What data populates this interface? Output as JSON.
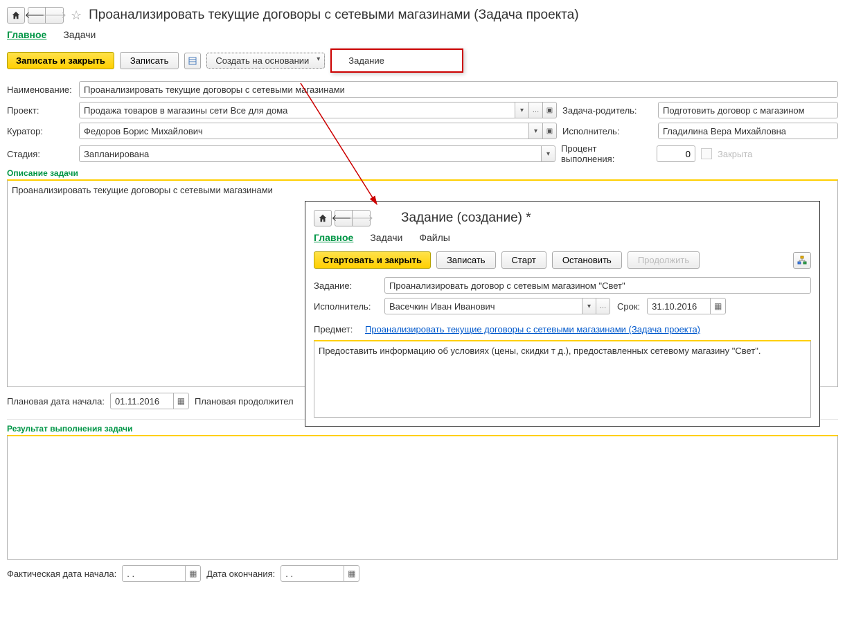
{
  "header": {
    "title": "Проанализировать текущие договоры с сетевыми магазинами (Задача проекта)"
  },
  "tabs": {
    "main": "Главное",
    "tasks": "Задачи"
  },
  "toolbar": {
    "save_close": "Записать и закрыть",
    "save": "Записать",
    "create_based_on": "Создать на основании",
    "based_on_item": "Задание"
  },
  "fields": {
    "name_label": "Наименование:",
    "name_value": "Проанализировать текущие договоры с сетевыми магазинами",
    "project_label": "Проект:",
    "project_value": "Продажа товаров в магазины сети Все для дома",
    "parent_label": "Задача-родитель:",
    "parent_value": "Подготовить договор с магазином",
    "curator_label": "Куратор:",
    "curator_value": "Федоров Борис Михайлович",
    "performer_label": "Исполнитель:",
    "performer_value": "Гладилина Вера Михайловна",
    "stage_label": "Стадия:",
    "stage_value": "Запланирована",
    "percent_label": "Процент выполнения:",
    "percent_value": "0",
    "closed_label": "Закрыта"
  },
  "description": {
    "title": "Описание задачи",
    "text": "Проанализировать текущие договоры с сетевыми магазинами"
  },
  "plan_dates": {
    "start_label": "Плановая дата начала:",
    "start_value": "01.11.2016",
    "duration_label": "Плановая продолжител"
  },
  "result": {
    "title": "Результат выполнения задачи"
  },
  "actual_dates": {
    "start_label": "Фактическая дата начала:",
    "start_value": "  .  .",
    "end_label": "Дата окончания:",
    "end_value": "  .  ."
  },
  "overlay": {
    "title": "Задание (создание) *",
    "tabs": {
      "main": "Главное",
      "tasks": "Задачи",
      "files": "Файлы"
    },
    "toolbar": {
      "start_close": "Стартовать и закрыть",
      "save": "Записать",
      "start": "Старт",
      "stop": "Остановить",
      "continue": "Продолжить"
    },
    "fields": {
      "task_label": "Задание:",
      "task_value": "Проанализировать договор с сетевым магазином \"Свет\"",
      "performer_label": "Исполнитель:",
      "performer_value": "Васечкин Иван Иванович",
      "due_label": "Срок:",
      "due_value": "31.10.2016",
      "subject_label": "Предмет:",
      "subject_link": "Проанализировать текущие договоры с сетевыми магазинами (Задача проекта)"
    },
    "description": "Предоставить информацию об условиях (цены, скидки т д.), предоставленных сетевому магазину \"Свет\"."
  }
}
